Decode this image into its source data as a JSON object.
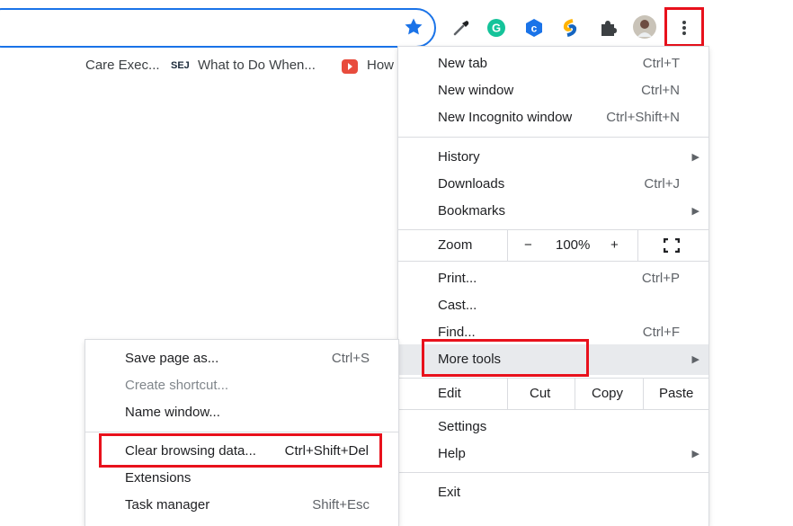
{
  "toolbar": {
    "star_icon": "bookmark-star-icon",
    "extensions": [
      "eyedropper-icon",
      "grammarly-icon",
      "c-shield-icon",
      "s-logo-icon",
      "puzzle-icon",
      "profile-avatar",
      "kebab-menu-icon"
    ]
  },
  "bookmarks": [
    {
      "label": "Care Exec..."
    },
    {
      "label": "What to Do When...",
      "icon": "SEJ"
    },
    {
      "label": "How"
    }
  ],
  "main_menu": {
    "new_tab": {
      "label": "New tab",
      "shortcut": "Ctrl+T"
    },
    "new_window": {
      "label": "New window",
      "shortcut": "Ctrl+N"
    },
    "incognito": {
      "label": "New Incognito window",
      "shortcut": "Ctrl+Shift+N"
    },
    "history": {
      "label": "History"
    },
    "downloads": {
      "label": "Downloads",
      "shortcut": "Ctrl+J"
    },
    "bookmarks": {
      "label": "Bookmarks"
    },
    "zoom": {
      "label": "Zoom",
      "minus": "−",
      "value": "100%",
      "plus": "+"
    },
    "print": {
      "label": "Print...",
      "shortcut": "Ctrl+P"
    },
    "cast": {
      "label": "Cast..."
    },
    "find": {
      "label": "Find...",
      "shortcut": "Ctrl+F"
    },
    "more_tools": {
      "label": "More tools"
    },
    "edit": {
      "label": "Edit",
      "cut": "Cut",
      "copy": "Copy",
      "paste": "Paste"
    },
    "settings": {
      "label": "Settings"
    },
    "help": {
      "label": "Help"
    },
    "exit": {
      "label": "Exit"
    }
  },
  "sub_menu": {
    "save_page": {
      "label": "Save page as...",
      "shortcut": "Ctrl+S"
    },
    "create_shortcut": {
      "label": "Create shortcut..."
    },
    "name_window": {
      "label": "Name window..."
    },
    "clear_data": {
      "label": "Clear browsing data...",
      "shortcut": "Ctrl+Shift+Del"
    },
    "extensions": {
      "label": "Extensions"
    },
    "task_manager": {
      "label": "Task manager",
      "shortcut": "Shift+Esc"
    }
  },
  "colors": {
    "highlight": "#e8111c",
    "accent": "#1a73e8"
  }
}
